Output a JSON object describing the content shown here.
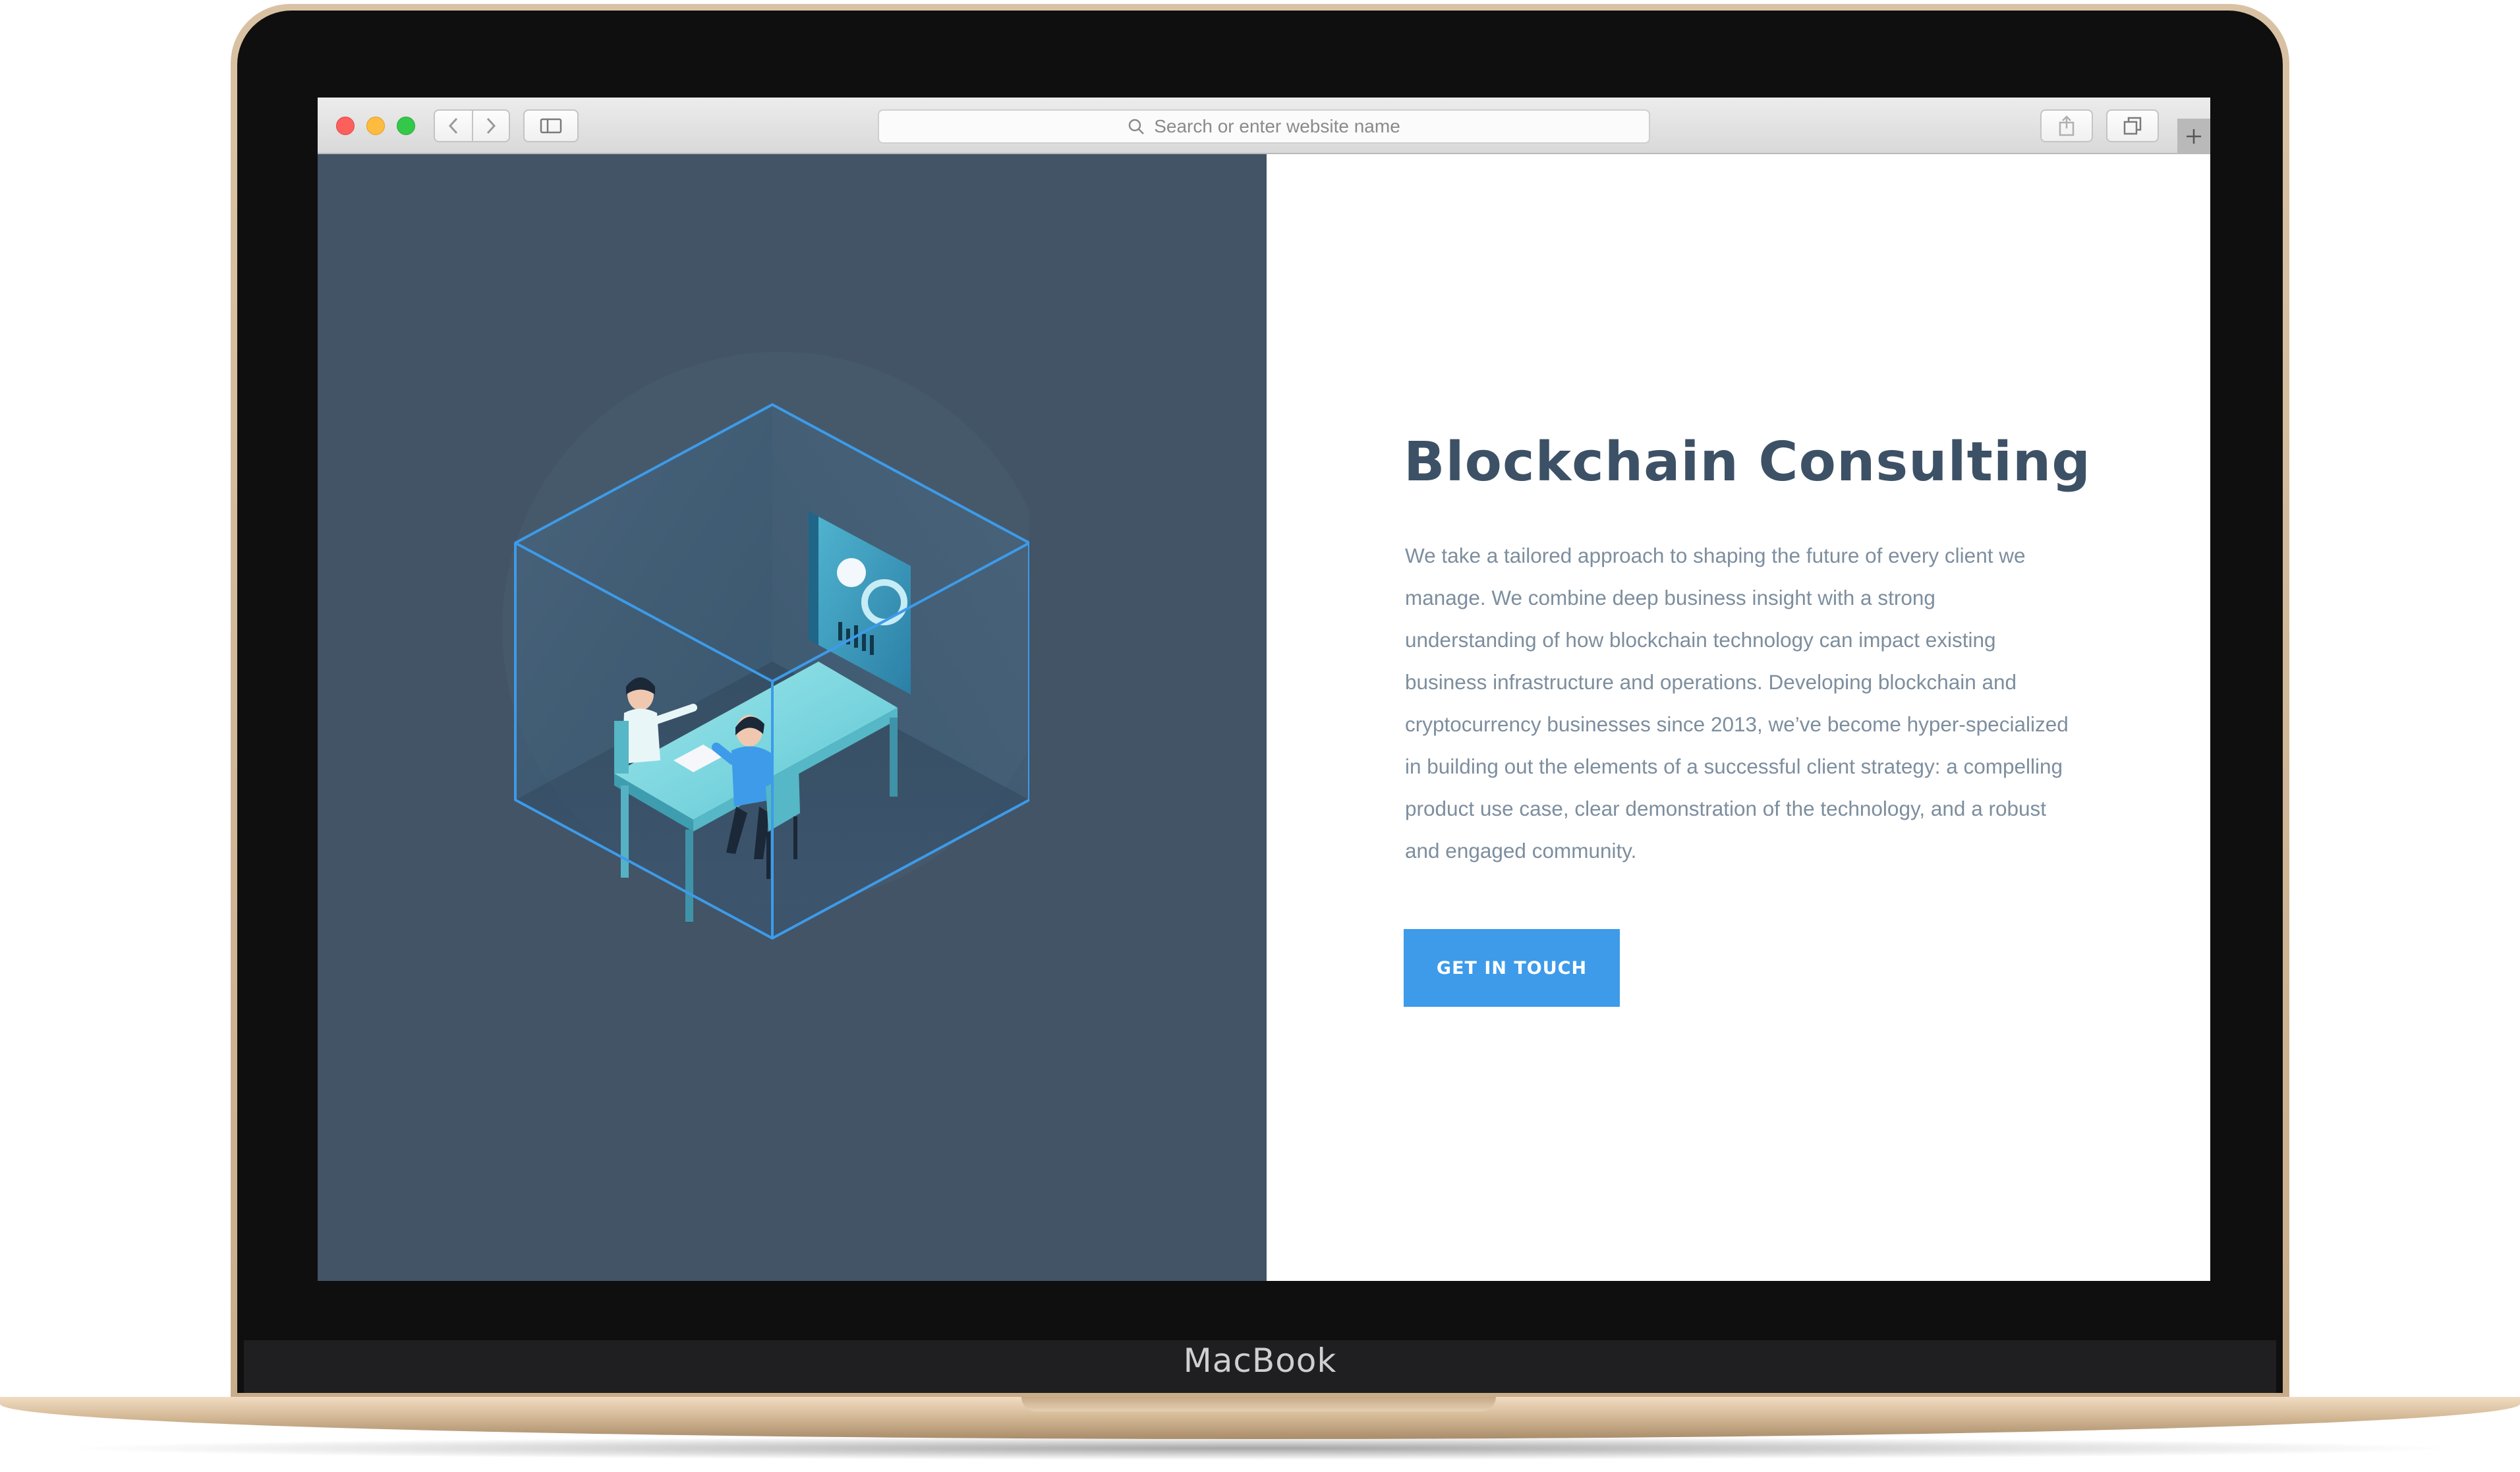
{
  "device": {
    "label": "MacBook"
  },
  "browser": {
    "address_placeholder": "Search or enter website name",
    "icons": {
      "close": "close-dot-icon",
      "minimize": "minimize-dot-icon",
      "zoom": "zoom-dot-icon",
      "back": "chevron-left-icon",
      "forward": "chevron-right-icon",
      "sidebar": "sidebar-icon",
      "search": "search-icon",
      "share": "share-icon",
      "tabs": "tabs-overview-icon",
      "new_tab": "plus-icon"
    },
    "colors": {
      "close": "#fc605c",
      "minimize": "#fdbc40",
      "zoom": "#34c84a"
    }
  },
  "hero": {
    "title": "Blockchain Consulting",
    "description": "We take a tailored approach to shaping the future of every client we manage. We combine deep business insight with a strong understanding of how blockchain technology can impact existing business infrastructure and operations. Developing blockchain and cryptocurrency businesses since 2013, we’ve become hyper-specialized in building out the elements of a successful client strategy: a compelling product use case, clear demonstration of the technology, and a robust and engaged community.",
    "cta_label": "GET IN TOUCH",
    "illustration": "isometric-consulting-office-illustration",
    "colors": {
      "left_panel": "#425466",
      "title": "#3d5166",
      "text": "#7d8e9e",
      "button": "#3d9be9"
    }
  }
}
